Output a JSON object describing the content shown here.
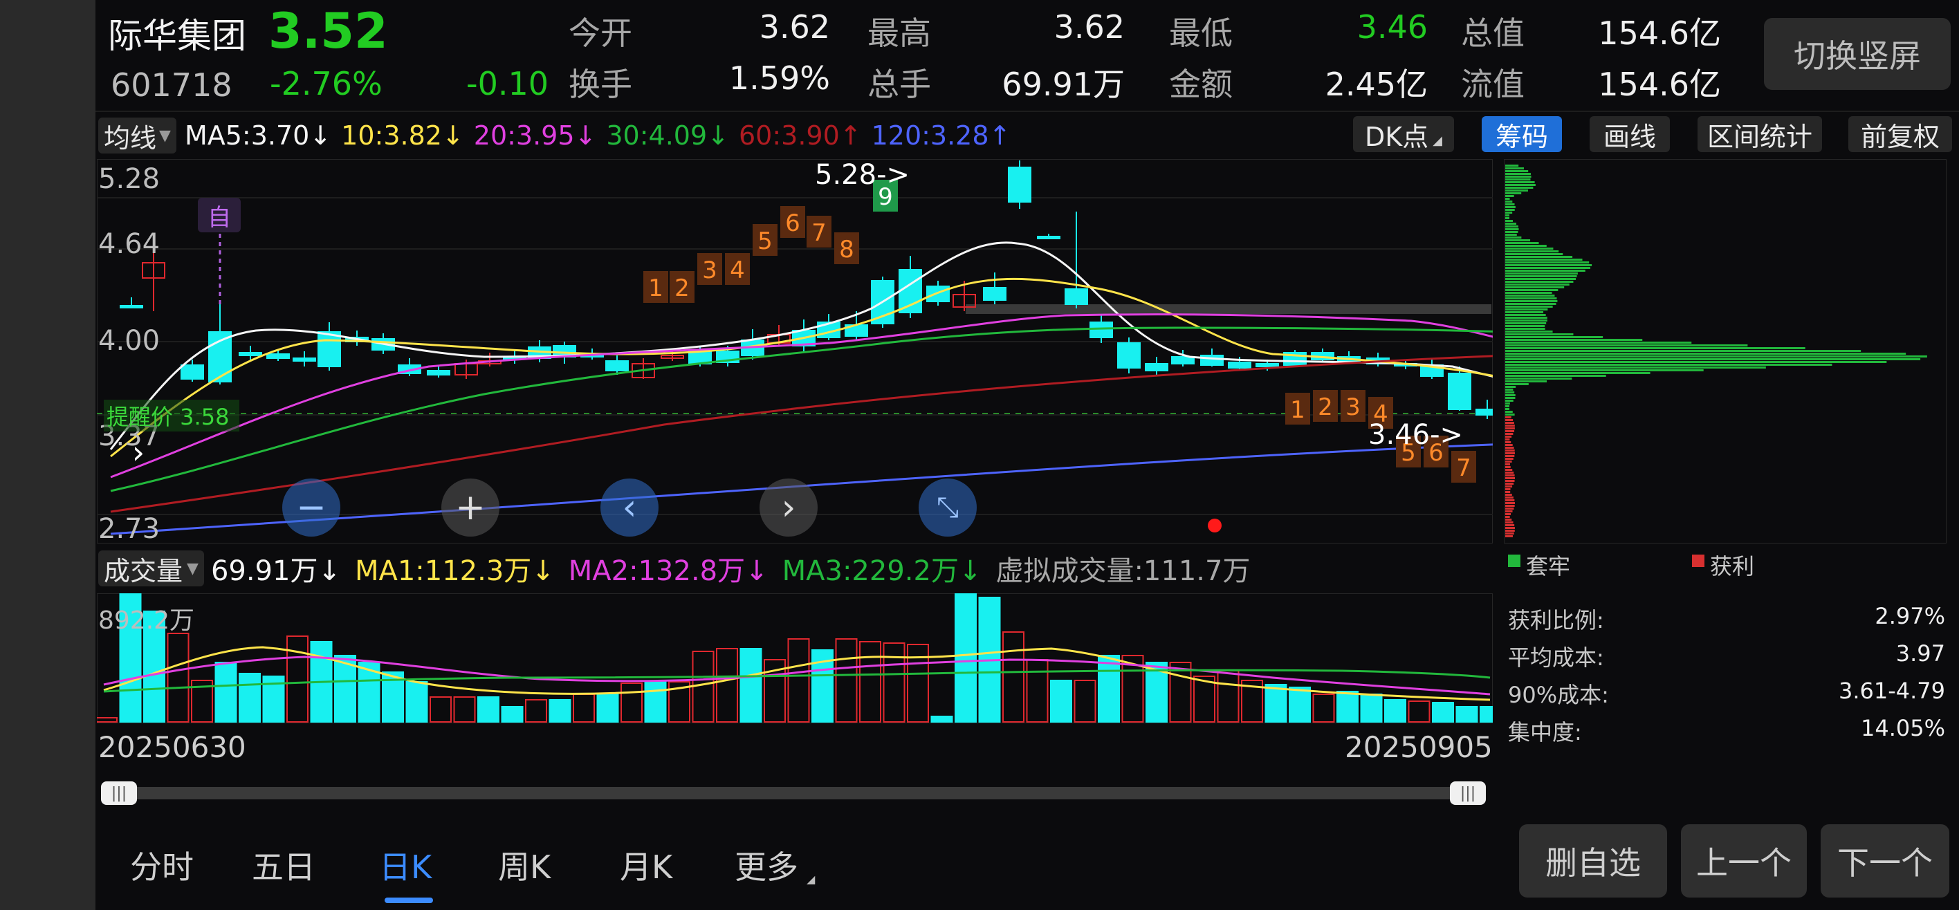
{
  "stock": {
    "name": "际华集团",
    "price": "3.52",
    "code": "601718",
    "pct": "-2.76%",
    "change": "-0.10"
  },
  "quotes": [
    {
      "label": "今开",
      "value": "3.62",
      "color": "#f0f0f0"
    },
    {
      "label": "最高",
      "value": "3.62",
      "color": "#f0f0f0"
    },
    {
      "label": "最低",
      "value": "3.46",
      "color": "#22cc22"
    },
    {
      "label": "总值",
      "value": "154.6亿",
      "color": "#f0f0f0"
    },
    {
      "label": "换手",
      "value": "1.59%",
      "color": "#f0f0f0"
    },
    {
      "label": "总手",
      "value": "69.91万",
      "color": "#f0f0f0"
    },
    {
      "label": "金额",
      "value": "2.45亿",
      "color": "#f0f0f0"
    },
    {
      "label": "流值",
      "value": "154.6亿",
      "color": "#f0f0f0"
    }
  ],
  "switch_label": "切换竖屏",
  "ma_dropdown": "均线",
  "ma_values": [
    {
      "text": "MA5:3.70↓",
      "color": "#f5f5f5"
    },
    {
      "text": "10:3.82↓",
      "color": "#ffe44a"
    },
    {
      "text": "20:3.95↓",
      "color": "#e040e0"
    },
    {
      "text": "30:4.09↓",
      "color": "#22b83c"
    },
    {
      "text": "60:3.90↑",
      "color": "#b01c22"
    },
    {
      "text": "120:3.28↑",
      "color": "#4e64ff"
    }
  ],
  "toolbar": {
    "dk": "DK点",
    "chips": "筹码",
    "draw": "画线",
    "interval": "区间统计",
    "adjust": "前复权"
  },
  "price_axis": [
    "5.28",
    "4.64",
    "4.00",
    "3.37",
    "2.73"
  ],
  "alert": "提醒价 3.58",
  "self_tag": "自",
  "high_label": "5.28->",
  "low_label": "3.46->",
  "vol_header": {
    "dropdown": "成交量",
    "volume": "69.91万↓",
    "ma1": "MA1:112.3万↓",
    "ma2": "MA2:132.8万↓",
    "ma3": "MA3:229.2万↓",
    "virtual": "虚拟成交量:111.7万"
  },
  "vol_max": "892.2万",
  "dates": {
    "start": "20250630",
    "end": "20250905"
  },
  "legend": {
    "trapped": "套牢",
    "profit": "获利"
  },
  "stats": [
    {
      "label": "获利比例:",
      "value": "2.97%"
    },
    {
      "label": "平均成本:",
      "value": "3.97"
    },
    {
      "label": "90%成本:",
      "value": "3.61-4.79"
    },
    {
      "label": "集中度:",
      "value": "14.05%"
    }
  ],
  "tabs": [
    "分时",
    "五日",
    "日K",
    "周K",
    "月K",
    "更多"
  ],
  "active_tab": "日K",
  "buttons": {
    "remove": "删自选",
    "prev": "上一个",
    "next": "下一个"
  },
  "td_up": [
    "1",
    "2",
    "3",
    "4",
    "5",
    "6",
    "7",
    "8",
    "9"
  ],
  "td_down": [
    "1",
    "2",
    "3",
    "4",
    "5",
    "6",
    "7"
  ],
  "colors": {
    "up": "#e0282e",
    "down": "#18f0f0",
    "green": "#22cc22",
    "accent": "#1f6fd8"
  }
}
